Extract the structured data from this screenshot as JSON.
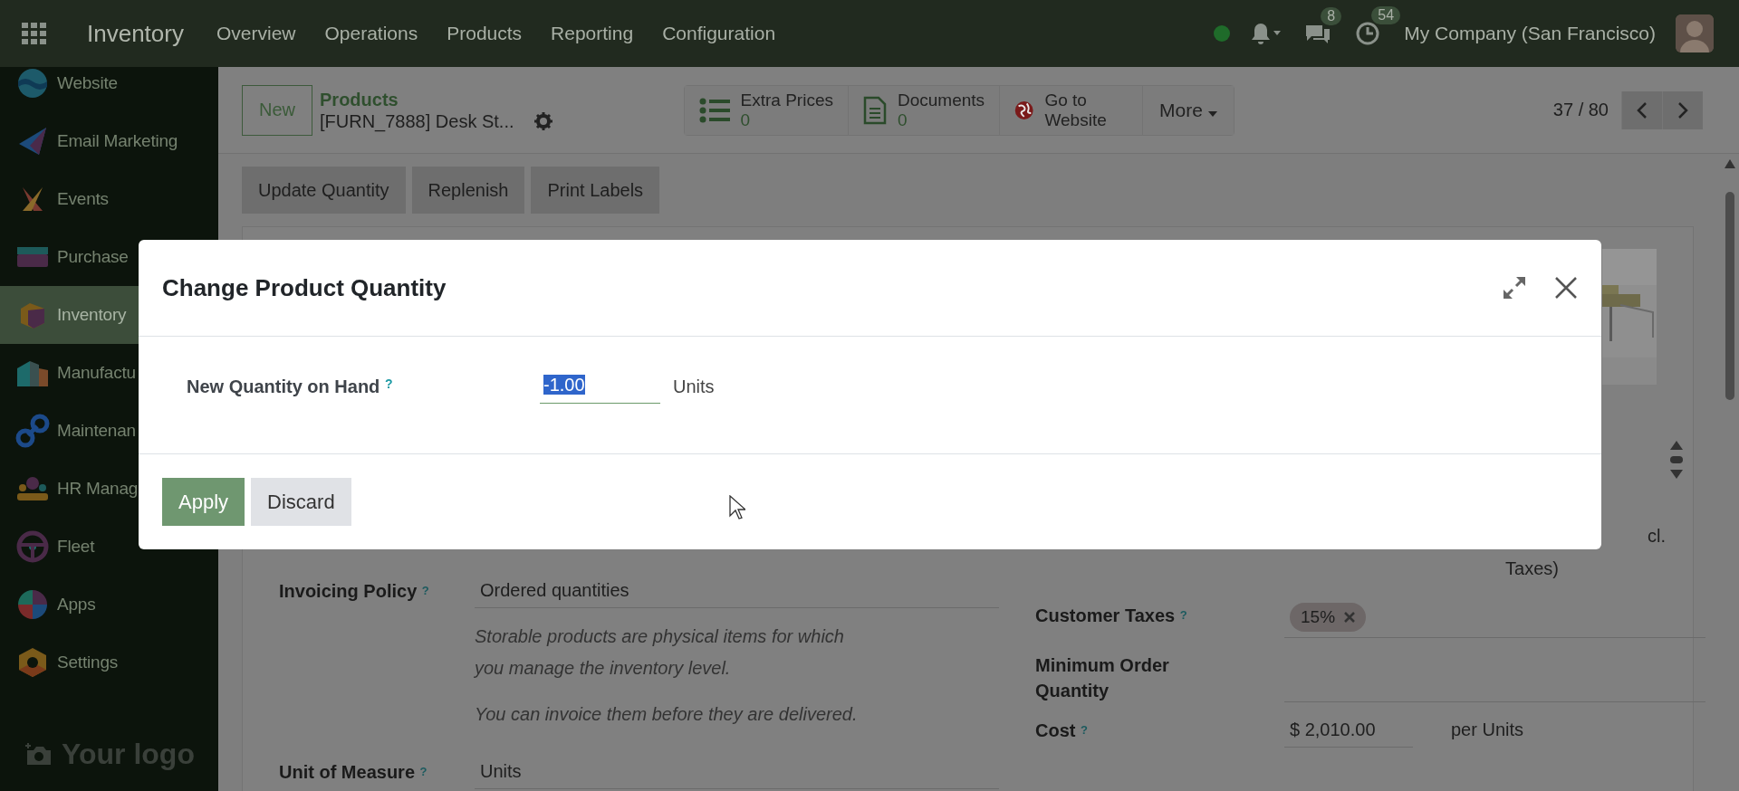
{
  "navbar": {
    "app_name": "Inventory",
    "menu": [
      "Overview",
      "Operations",
      "Products",
      "Reporting",
      "Configuration"
    ],
    "presence_online": true,
    "messages_count": "8",
    "activities_count": "54",
    "company": "My Company (San Francisco)"
  },
  "sidebar": {
    "items": [
      {
        "label": "Website",
        "kind": "website",
        "selected": false
      },
      {
        "label": "Email Marketing",
        "kind": "email",
        "selected": false
      },
      {
        "label": "Events",
        "kind": "events",
        "selected": false
      },
      {
        "label": "Purchase",
        "kind": "purchase",
        "selected": false
      },
      {
        "label": "Inventory",
        "kind": "inventory",
        "selected": true
      },
      {
        "label": "Manufactu",
        "kind": "manufacturing",
        "selected": false
      },
      {
        "label": "Maintenan",
        "kind": "maintenance",
        "selected": false
      },
      {
        "label": "HR Manag",
        "kind": "hr",
        "selected": false
      },
      {
        "label": "Fleet",
        "kind": "fleet",
        "selected": false
      },
      {
        "label": "Apps",
        "kind": "apps",
        "selected": false
      },
      {
        "label": "Settings",
        "kind": "settings",
        "selected": false
      }
    ],
    "logo": "Your logo"
  },
  "control_panel": {
    "new_button": "New",
    "breadcrumb": "Products",
    "record_title": "[FURN_7888] Desk St...",
    "stat_buttons": [
      {
        "kind": "list",
        "label": "Extra Prices",
        "value": "0"
      },
      {
        "kind": "document",
        "label": "Documents",
        "value": "0"
      },
      {
        "kind": "globe",
        "label": "Go to Website"
      }
    ],
    "more_button": "More",
    "pager": "37 / 80"
  },
  "actions": [
    "Update Quantity",
    "Replenish",
    "Print Labels"
  ],
  "form": {
    "partial_texts": [
      "cl.",
      "Taxes)"
    ],
    "left_fields": [
      {
        "label": "Invoicing Policy",
        "help": "?",
        "value": "Ordered quantities",
        "notes": [
          "Storable products are physical items for which you manage the inventory level.",
          "You can invoice them before they are delivered."
        ]
      },
      {
        "label": "Unit of Measure",
        "help": "?",
        "value": "Units"
      }
    ],
    "right_fields": [
      {
        "label": "Customer Taxes",
        "help": "?",
        "tags": [
          "15%"
        ]
      },
      {
        "label": "Minimum Order Quantity"
      },
      {
        "label": "Cost",
        "help": "?",
        "value": "$ 2,010.00",
        "suffix": "per Units"
      }
    ]
  },
  "dialog": {
    "title": "Change Product Quantity",
    "field_label": "New Quantity on Hand",
    "help": "?",
    "value": "-1.00",
    "value_selected": true,
    "unit": "Units",
    "buttons": [
      {
        "label": "Apply",
        "kind": "primary"
      },
      {
        "label": "Discard",
        "kind": "secondary"
      }
    ]
  }
}
